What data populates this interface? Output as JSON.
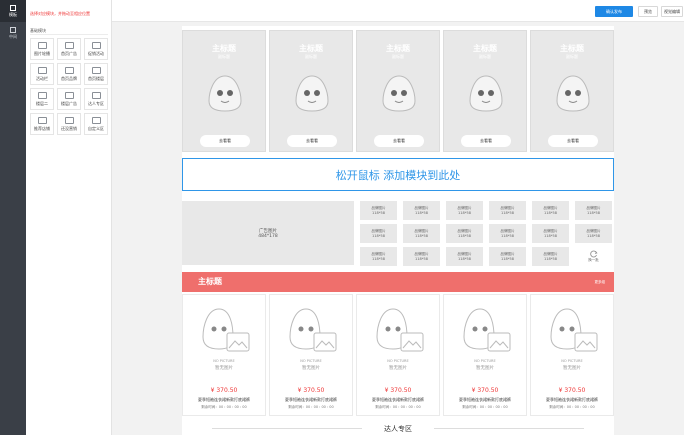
{
  "rail": {
    "items": [
      {
        "label": "模板",
        "icon": "grid-icon",
        "active": true
      },
      {
        "label": "中间",
        "icon": "layout-icon",
        "active": false
      }
    ]
  },
  "panel": {
    "hint": "选择对应模块，并拖动至相应位置",
    "group_title": "基础模块",
    "modules": [
      {
        "label": "图片轮播",
        "icon": "image-icon"
      },
      {
        "label": "首页广告",
        "icon": "ad-icon"
      },
      {
        "label": "促销活动",
        "icon": "tag-icon"
      },
      {
        "label": "活动栏",
        "icon": "activity-icon"
      },
      {
        "label": "首页品牌",
        "icon": "crown-icon"
      },
      {
        "label": "首页楼层",
        "icon": "floor-icon"
      },
      {
        "label": "楼层二",
        "icon": "floor2-icon"
      },
      {
        "label": "楼层广告",
        "icon": "floor-ad-icon"
      },
      {
        "label": "达人专区",
        "icon": "star-icon"
      },
      {
        "label": "推荐店铺",
        "icon": "shop-icon"
      },
      {
        "label": "还没营销",
        "icon": "marketing-icon"
      },
      {
        "label": "自定义区",
        "icon": "edit-icon"
      }
    ]
  },
  "topbar": {
    "publish": "确认发布",
    "preview": "预览",
    "visual_edit": "视觉编辑"
  },
  "hero": {
    "items": [
      {
        "title": "主标题",
        "subtitle": "副标题",
        "button": "去看看"
      },
      {
        "title": "主标题",
        "subtitle": "副标题",
        "button": "去看看"
      },
      {
        "title": "主标题",
        "subtitle": "副标题",
        "button": "去看看"
      },
      {
        "title": "主标题",
        "subtitle": "副标题",
        "button": "去看看"
      },
      {
        "title": "主标题",
        "subtitle": "副标题",
        "button": "去看看"
      }
    ]
  },
  "dropzone": {
    "text": "松开鼠标 添加模块到此处"
  },
  "ad": {
    "label": "广告图片",
    "size": "484*178"
  },
  "brands": {
    "items": [
      {
        "label": "品牌图片",
        "size": "118*58"
      },
      {
        "label": "品牌图片",
        "size": "118*58"
      },
      {
        "label": "品牌图片",
        "size": "118*58"
      },
      {
        "label": "品牌图片",
        "size": "118*58"
      },
      {
        "label": "品牌图片",
        "size": "118*58"
      },
      {
        "label": "品牌图片",
        "size": "118*58"
      },
      {
        "label": "品牌图片",
        "size": "118*58"
      },
      {
        "label": "品牌图片",
        "size": "118*58"
      },
      {
        "label": "品牌图片",
        "size": "118*58"
      },
      {
        "label": "品牌图片",
        "size": "118*58"
      },
      {
        "label": "品牌图片",
        "size": "118*58"
      },
      {
        "label": "品牌图片",
        "size": "118*58"
      },
      {
        "label": "品牌图片",
        "size": "118*58"
      },
      {
        "label": "品牌图片",
        "size": "118*58"
      },
      {
        "label": "品牌图片",
        "size": "118*58"
      },
      {
        "label": "品牌图片",
        "size": "118*58"
      },
      {
        "label": "品牌图片",
        "size": "118*58"
      }
    ],
    "refresh_label": "换一批"
  },
  "floor": {
    "title": "主标题",
    "more": "更多组",
    "products": [
      {
        "noimg_en": "NO PICTURE",
        "noimg_cn": "暂无图片",
        "price": "¥ 370.50",
        "name": "夏季短袖连衣裙新款打底裙裤",
        "time": "剩余时间：00 : 00 : 00 : 00"
      },
      {
        "noimg_en": "NO PICTURE",
        "noimg_cn": "暂无图片",
        "price": "¥ 370.50",
        "name": "夏季短袖连衣裙新款打底裙裤",
        "time": "剩余时间：00 : 00 : 00 : 00"
      },
      {
        "noimg_en": "NO PICTURE",
        "noimg_cn": "暂无图片",
        "price": "¥ 370.50",
        "name": "夏季短袖连衣裙新款打底裙裤",
        "time": "剩余时间：00 : 00 : 00 : 00"
      },
      {
        "noimg_en": "NO PICTURE",
        "noimg_cn": "暂无图片",
        "price": "¥ 370.50",
        "name": "夏季短袖连衣裙新款打底裙裤",
        "time": "剩余时间：00 : 00 : 00 : 00"
      },
      {
        "noimg_en": "NO PICTURE",
        "noimg_cn": "暂无图片",
        "price": "¥ 370.50",
        "name": "夏季短袖连衣裙新款打底裙裤",
        "time": "剩余时间：00 : 00 : 00 : 00"
      }
    ]
  },
  "section": {
    "title": "达人专区"
  },
  "colors": {
    "accent": "#1e88e5",
    "floor_red": "#ef6f6c",
    "price": "#e33333",
    "dropzone": "#2f96e8"
  }
}
